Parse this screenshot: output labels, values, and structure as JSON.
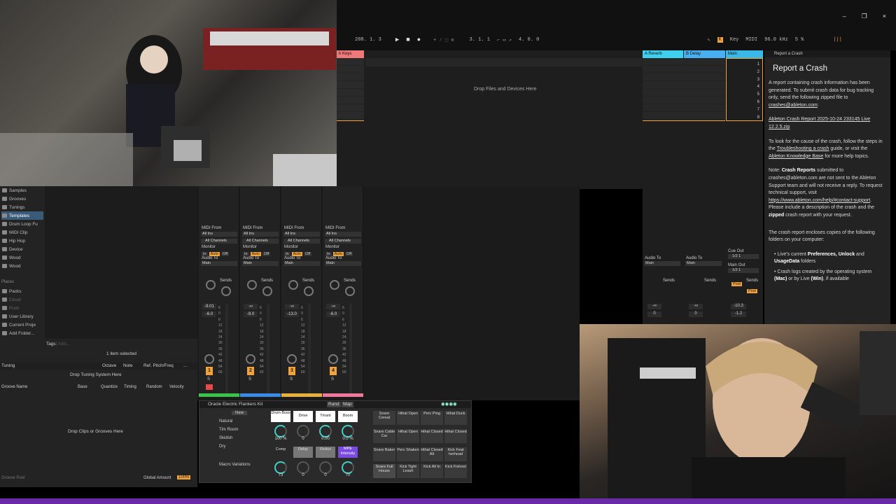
{
  "colors": {
    "accent": "#f2a23a",
    "reverb": "#3fd0f0",
    "delay": "#48b0f0",
    "main": "#3ab8e8",
    "keys": "#f07878",
    "mpe": "#7b4be0",
    "taskbar": "#6a2aa8"
  },
  "window_controls": {
    "minimize": "–",
    "restore": "❐",
    "close": "×"
  },
  "transport": {
    "bpm": "208. 1. 3",
    "position": "3. 1. 1",
    "loop_length": "4. 0. 0",
    "key_label": "Key",
    "midi_label": "MIDI",
    "sample_rate": "96.0 kHz",
    "cpu": "5 %"
  },
  "session": {
    "tracks": [
      {
        "name": "h Keys"
      }
    ],
    "drop_files": "Drop Files and Devices Here",
    "return_tracks": [
      {
        "name": "A Reverb"
      },
      {
        "name": "B Delay"
      },
      {
        "name": "Main"
      }
    ],
    "scenes": [
      "1",
      "2",
      "3",
      "4",
      "5",
      "6",
      "7",
      "8"
    ]
  },
  "crash_dialog": {
    "header": "Report a Crash",
    "title": "Report a Crash",
    "p1": "A report containing crash information has been generated. To submit crash data for bug tracking only, send the following zipped file to",
    "email": "crashes@ableton.com",
    "file_link": "Ableton Crash Report 2025-10-24 233145 Live 12.2.5.zip",
    "p3a": "To look for the cause of the crash, follow the steps in the",
    "troubleshooting_link": "Troubleshooting a crash",
    "p3b": "guide, or visit the",
    "kb_link": "Ableton Knowledge Base",
    "p3c": "for more help topics.",
    "p4a": "Note:",
    "p4b": "Crash Reports",
    "p4c": "submitted to crashes@ableton.com are not sent to the Ableton Support team and will not receive a reply. To request technical support, visit",
    "support_link": "https://www.ableton.com/help/#contact-support",
    "p4d": ". Please include a description of the crash and the",
    "p4e": "zipped",
    "p4f": "crash report with your request.",
    "p5": "The crash report encloses copies of the following folders on your computer:",
    "b1a": "Live's current",
    "b1b": "Preferences, Unlock",
    "b1c": "and",
    "b1d": "UsageData",
    "b1e": "folders",
    "b2a": "Crash logs created by the operating system",
    "b2b": "(Mac)",
    "b2c": "or by Live",
    "b2d": "(Win)",
    "b2e": ", if available"
  },
  "browser": {
    "items": [
      {
        "label": "Samples"
      },
      {
        "label": "Grooves"
      },
      {
        "label": "Tunings"
      },
      {
        "label": "Templates",
        "active": true
      },
      {
        "label": "Drum Loop Fu"
      },
      {
        "label": "MIDI Clip"
      },
      {
        "label": "Hip Hop"
      },
      {
        "label": "Device"
      },
      {
        "label": "Wood"
      },
      {
        "label": "Wood"
      }
    ],
    "places_label": "Places",
    "places": [
      {
        "label": "Packs"
      },
      {
        "label": "Cloud"
      },
      {
        "label": "Push"
      },
      {
        "label": "User Library"
      },
      {
        "label": "Current Proje"
      },
      {
        "label": "Add Folder..."
      }
    ],
    "tags_label": "Tags:",
    "tags_placeholder": "Add...",
    "selection": "1 item selected"
  },
  "tuning": {
    "label": "Tuning",
    "octave": "Octave",
    "note": "Note",
    "ref": "Ref. Pitch/Freq",
    "more": "...",
    "drop": "Drop Tuning System Here"
  },
  "groove_pool": {
    "headers": [
      "Groove Name",
      "Base",
      "Quantize",
      "Timing",
      "Random",
      "Velocity"
    ],
    "drop": "Drop Clips or Grooves Here",
    "footer_left": "Groove Pool",
    "global_amount_label": "Global Amount",
    "global_amount": "100%"
  },
  "mixer": {
    "strips": [
      {
        "midi_from": "All Ins",
        "channel": "All Channels",
        "audio_to": "Main",
        "vol": "-9.01",
        "pan": "-6.0",
        "num": "1"
      },
      {
        "midi_from": "All Ins",
        "channel": "All Channels",
        "audio_to": "Main",
        "vol": "-∞",
        "pan": "-9.0",
        "num": "2"
      },
      {
        "midi_from": "All Ins",
        "channel": "All Channels",
        "audio_to": "Main",
        "vol": "-∞",
        "pan": "-13.0",
        "num": "3"
      },
      {
        "midi_from": "All Ins",
        "channel": "All Channels",
        "audio_to": "Main",
        "vol": "-∞",
        "pan": "-6.0",
        "num": "4"
      }
    ],
    "labels": {
      "midi_from": "MIDI From",
      "monitor": "Monitor",
      "in": "In",
      "auto": "Auto",
      "off": "Off",
      "audio_to": "Audio To",
      "sends": "Sends",
      "a": "A",
      "b": "B",
      "s": "S"
    },
    "scale": [
      "6",
      "0",
      "6",
      "12",
      "18",
      "24",
      "30",
      "36",
      "42",
      "48",
      "54",
      "60"
    ],
    "returns": [
      {
        "audio_to": "Main",
        "vol": "-∞",
        "pan": "0"
      },
      {
        "audio_to": "Main",
        "vol": "-∞",
        "pan": "0"
      }
    ],
    "main": {
      "cue_out": "Cue Out",
      "cue_val": "1/2 1",
      "main_out": "Main Out",
      "main_val": "1/2 1",
      "vol": "-10.3",
      "pan": "-1.2",
      "post": "Post"
    }
  },
  "rack": {
    "title": "Oracle Electric Flankers Kit",
    "rand": "Rand",
    "map": "Map",
    "new": "New",
    "variations": [
      "Natural",
      "Tim Room",
      "Skidish",
      "Dry"
    ],
    "macro_variations": "Macro Variations",
    "macros_row1": [
      {
        "label": "Drum Buss",
        "value": "100 %"
      },
      {
        "label": "Drive",
        "value": "0"
      },
      {
        "label": "Trnsnt",
        "value": "0.00"
      },
      {
        "label": "Boom",
        "value": "0.0 %"
      }
    ],
    "macros_row2": [
      {
        "label": "Comp",
        "value": "73"
      },
      {
        "label": "Delay",
        "value": "0"
      },
      {
        "label": "Redux",
        "value": "0"
      },
      {
        "label": "MPE Intensity",
        "value": "70"
      }
    ],
    "pads": [
      "Snare Cereal",
      "Hihat Open",
      "Perc Ping",
      "Hihat Duck",
      "Snare Cable Car",
      "Hihat Open",
      "Hihat Closed",
      "Hihat Closed",
      "Snare Baker",
      "Perc Shaken",
      "Hihat Closed Alt",
      "Kick Feat herhead",
      "Snare Full House",
      "Kick Tight Leash",
      "Kick All In",
      "Kick Fishnet"
    ],
    "pad_controls": "M ▸ S"
  }
}
